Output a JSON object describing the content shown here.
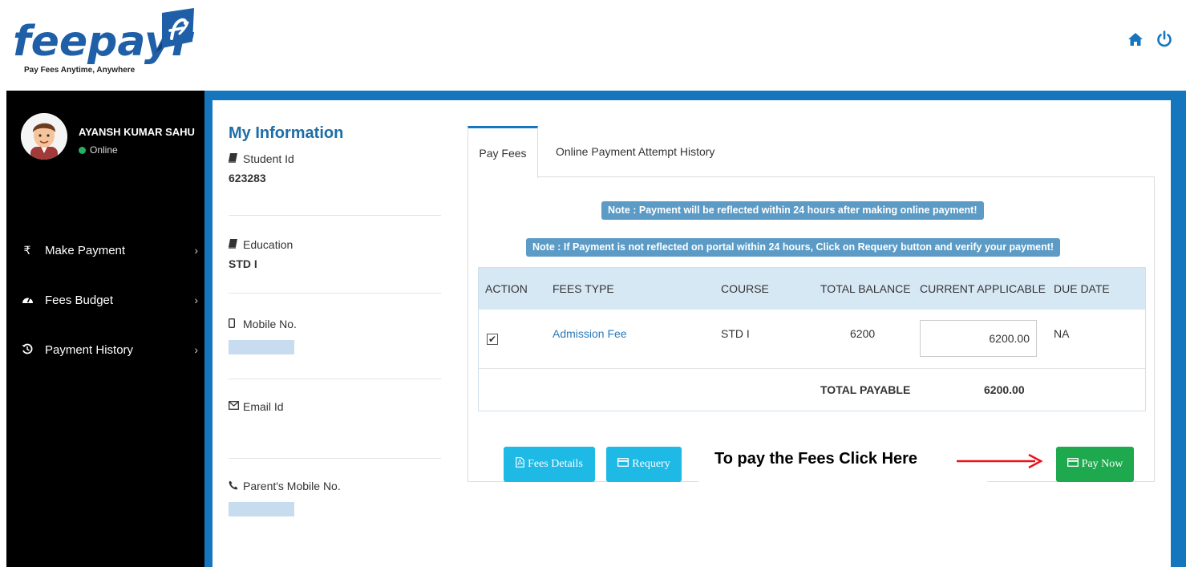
{
  "brand": {
    "name": "feepayr",
    "tagline": "Pay Fees Anytime, Anywhere",
    "color": "#1e5fa8"
  },
  "header": {
    "icons": [
      "home-icon",
      "power-icon"
    ]
  },
  "sidebar": {
    "user_name": "AYANSH KUMAR SAHU",
    "status": "Online",
    "items": [
      {
        "label": "Make Payment",
        "icon": "rupee-icon"
      },
      {
        "label": "Fees Budget",
        "icon": "dashboard-icon"
      },
      {
        "label": "Payment History",
        "icon": "history-icon"
      }
    ]
  },
  "info": {
    "title": "My Information",
    "student_id_label": "Student Id",
    "student_id": "623283",
    "education_label": "Education",
    "education": "STD I",
    "mobile_label": "Mobile No.",
    "email_label": "Email Id",
    "parent_mobile_label": "Parent's Mobile No."
  },
  "tabs": [
    {
      "label": "Pay Fees",
      "active": true
    },
    {
      "label": "Online Payment Attempt History",
      "active": false
    }
  ],
  "notes": {
    "note1": "Note : Payment will be reflected within 24 hours after making online payment!",
    "note2": "Note : If Payment is not reflected on portal within 24 hours, Click on Requery button and verify your payment!"
  },
  "table": {
    "headers": [
      "ACTION",
      "FEES TYPE",
      "COURSE",
      "TOTAL BALANCE",
      "CURRENT APPLICABLE",
      "DUE DATE"
    ],
    "rows": [
      {
        "checked": true,
        "fees_type": "Admission Fee",
        "course": "STD I",
        "total_balance": "6200",
        "current_applicable": "6200.00",
        "due_date": "NA"
      }
    ],
    "total_label": "TOTAL PAYABLE",
    "total_value": "6200.00"
  },
  "buttons": {
    "fees_details": "Fees Details",
    "requery": "Requery",
    "pay_now": "Pay Now"
  },
  "hint": {
    "text": "To pay the Fees Click Here",
    "arrow_color": "#e8141a"
  },
  "colors": {
    "accent": "#1576bd",
    "info_btn": "#1fb9e6",
    "pay_btn": "#1fa94e",
    "note_bg": "#5b9bc6"
  }
}
